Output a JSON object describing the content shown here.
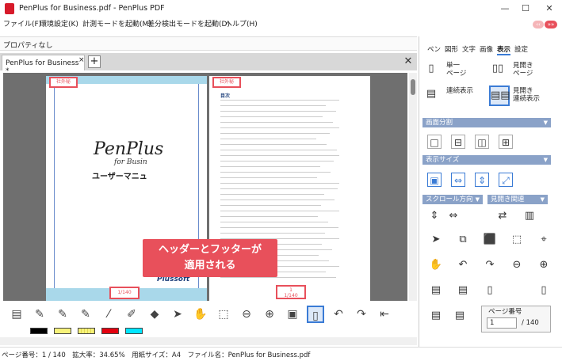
{
  "window": {
    "title": "PenPlus for Business.pdf - PenPlus PDF",
    "minimize": "—",
    "maximize": "☐",
    "close": "✕"
  },
  "menu": [
    "ファイル(F)",
    "環境設定(K)",
    "計測モードを起動(M)",
    "差分検出モードを起動(D)",
    "ヘルプ(H)"
  ],
  "propbar": {
    "label": "プロパティなし"
  },
  "tabs": {
    "doc_tab": "PenPlus for Business *",
    "tab_close": "×",
    "add": "+",
    "close_all": "✕"
  },
  "page1": {
    "header": "社外秘",
    "logo": "PenPlus",
    "logo_sub": "for Busin",
    "heading": "ユーザーマニュ",
    "company": "Plussoft",
    "footer": "1/140"
  },
  "page2": {
    "header": "社外秘",
    "toc_title": "目次",
    "footer_num": "1",
    "footer": "1/140"
  },
  "callout": {
    "line1": "ヘッダーとフッターが",
    "line2": "適用される"
  },
  "bottom_toolbar": {
    "icons": [
      "stamp-icon",
      "highlighter-icon",
      "marker-icon",
      "pen-icon",
      "brush-icon",
      "abc-stamp-icon",
      "eraser-icon",
      "select-arrow-icon",
      "hand-icon",
      "area-select-icon",
      "zoom-out-icon",
      "zoom-in-icon",
      "fit-page-icon",
      "page-icon",
      "undo-icon",
      "redo-icon",
      "first-page-icon"
    ],
    "swatches": [
      "#000000",
      "#f7f27a",
      "#f7f27a",
      "#e3000f",
      "#00e5ff"
    ]
  },
  "status": {
    "text": "ページ番号：1 / 140　拡大率：34.65%　用紙サイズ：A4　ファイル名：PenPlus for Business.pdf"
  },
  "right_panel": {
    "tabs": [
      "ペン",
      "図形",
      "文字",
      "画像",
      "表示",
      "設定"
    ],
    "active_tab": "表示",
    "view_buttons": [
      {
        "label": "単一\nページ"
      },
      {
        "label": "見開き\nページ"
      },
      {
        "label": "連続表示"
      },
      {
        "label": "見開き\n連続表示"
      }
    ],
    "split_title": "画面分割",
    "size_title": "表示サイズ",
    "scroll_title": "スクロール方向",
    "spread_title": "見開き関連",
    "page_label": "ページ番号",
    "page_value": "1",
    "page_total": "/ 140"
  },
  "colors": {
    "accent": "#e8505b",
    "section": "#8aa2c8"
  }
}
